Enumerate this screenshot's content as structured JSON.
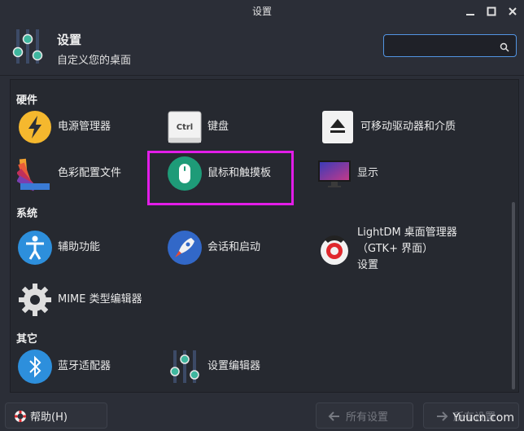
{
  "window": {
    "title": "设置"
  },
  "header": {
    "title": "设置",
    "subtitle": "自定义您的桌面",
    "search_placeholder": ""
  },
  "sections": {
    "hardware": "硬件",
    "system": "系统",
    "other": "其它"
  },
  "items": {
    "power": "电源管理器",
    "keyboard": "键盘",
    "removable": "可移动驱动器和介质",
    "color": "色彩配置文件",
    "mouse": "鼠标和触摸板",
    "display": "显示",
    "accessibility": "辅助功能",
    "session": "会话和启动",
    "lightdm_line1": "LightDM 桌面管理器（GTK+ 界面）",
    "lightdm_line2": "设置",
    "mime": "MIME 类型编辑器",
    "bluetooth": "蓝牙适配器",
    "settings_editor": "设置编辑器"
  },
  "keyboard_icon_text": "Ctrl",
  "footer": {
    "help": "帮助(H)",
    "all_settings": "所有设置",
    "all_settings_right": "所有设置"
  },
  "watermark": "Yuucn.com",
  "colors": {
    "accent": "#5294e2",
    "highlight": "#e21de8"
  }
}
